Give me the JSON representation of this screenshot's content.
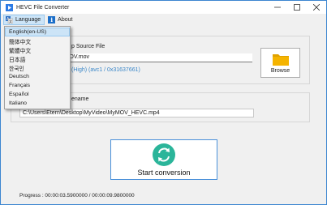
{
  "window": {
    "title": "HEVC File Converter"
  },
  "menubar": {
    "language": "Language",
    "about": "About",
    "about_icon_glyph": "i"
  },
  "language_menu": {
    "items": [
      "English(en-US)",
      "簡体中文",
      "繁體中文",
      "日本語",
      "한국인",
      "Deutsch",
      "Français",
      "Español",
      "Italiano"
    ],
    "selected": "English(en-US)"
  },
  "source": {
    "label": "p Source File",
    "path": "ktop\\MyVideo\\MyMOV.mov",
    "codec": "(High) (avc1 / 0x31637661)"
  },
  "browse": {
    "label": "Browse"
  },
  "output": {
    "label": "ename",
    "path": "C:\\Users\\Etern\\Desktop\\MyVideo\\MyMOV_HEVC.mp4"
  },
  "start": {
    "label": "Start conversion"
  },
  "progress": {
    "text": "Progress : 00:00:03.5900000 / 00:00:09.9800000"
  },
  "colors": {
    "accent": "#3c86d0",
    "codec_text": "#3b87c8",
    "folder": "#f5b400",
    "convert_icon": "#2bb59a"
  }
}
